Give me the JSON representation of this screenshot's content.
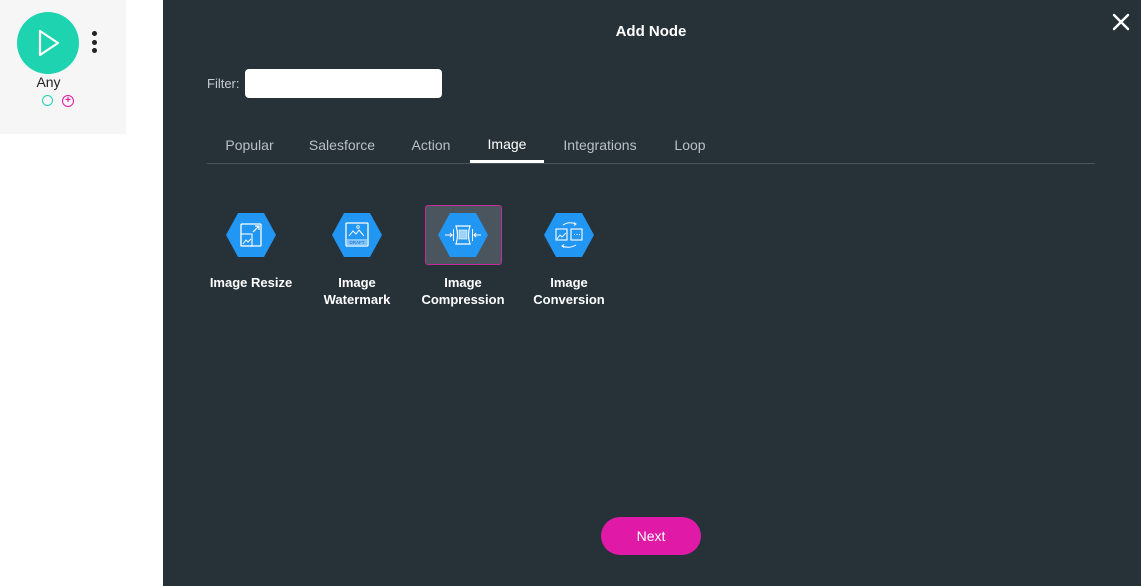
{
  "canvas": {
    "node": {
      "label": "Any",
      "icon": "play-icon",
      "menu_icon": "kebab-menu-icon",
      "input_port_icon": "circle-port-icon",
      "output_port_icon": "plus-circle-icon"
    }
  },
  "modal": {
    "title": "Add Node",
    "close_icon": "close-icon",
    "filter": {
      "label": "Filter:",
      "value": "",
      "placeholder": ""
    },
    "tabs": [
      {
        "label": "Popular",
        "active": false
      },
      {
        "label": "Salesforce",
        "active": false
      },
      {
        "label": "Action",
        "active": false
      },
      {
        "label": "Image",
        "active": true
      },
      {
        "label": "Integrations",
        "active": false
      },
      {
        "label": "Loop",
        "active": false
      }
    ],
    "nodes": [
      {
        "label_line1": "Image Resize",
        "label_line2": "",
        "icon": "image-resize-icon",
        "selected": false
      },
      {
        "label_line1": "Image",
        "label_line2": "Watermark",
        "icon": "image-watermark-icon",
        "watermark_text": "DRAFT",
        "selected": false
      },
      {
        "label_line1": "Image",
        "label_line2": "Compression",
        "icon": "image-compression-icon",
        "selected": true
      },
      {
        "label_line1": "Image",
        "label_line2": "Conversion",
        "icon": "image-conversion-icon",
        "selected": false
      }
    ],
    "next_label": "Next"
  },
  "colors": {
    "modal_bg": "#263138",
    "accent": "#e01aa6",
    "start_node": "#1dd3b0",
    "hex_icon": "#2196f3"
  }
}
